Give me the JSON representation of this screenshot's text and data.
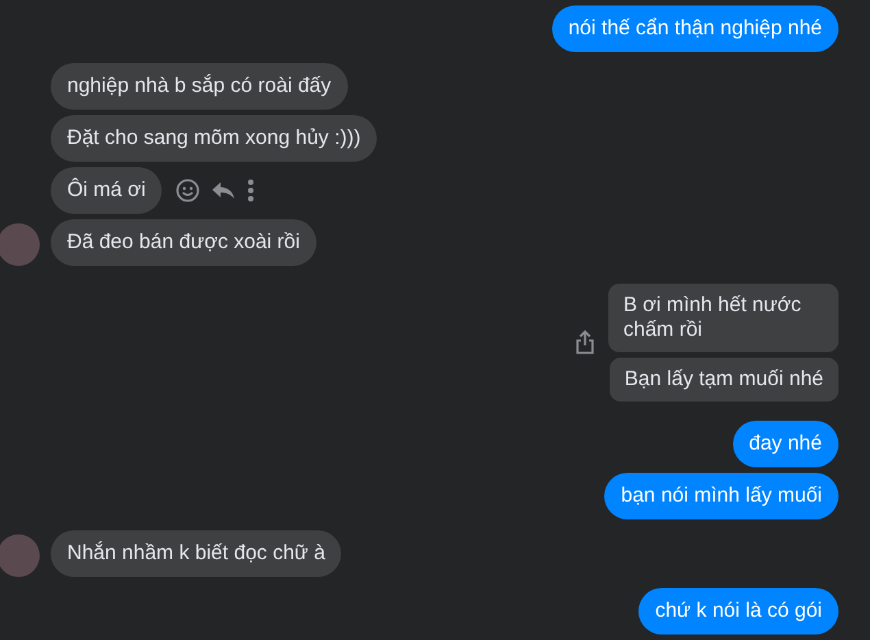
{
  "groups": [
    {
      "kind": "outgoing",
      "avatar": false,
      "share_icon": false,
      "messages": [
        {
          "text": "nói thế cẩn thận nghiệp nhé",
          "kind": "blue",
          "actions": false
        }
      ]
    },
    {
      "kind": "incoming",
      "avatar": true,
      "share_icon": false,
      "messages": [
        {
          "text": "nghiệp nhà b sắp có roài đấy",
          "kind": "grey",
          "actions": false
        },
        {
          "text": "Đặt cho sang mõm xong hủy :)))",
          "kind": "grey",
          "actions": false
        },
        {
          "text": "Ôi má ơi",
          "kind": "grey",
          "actions": true
        },
        {
          "text": "Đã đeo bán được xoài rồi",
          "kind": "grey",
          "actions": false
        }
      ]
    },
    {
      "kind": "outgoing",
      "avatar": false,
      "share_icon": true,
      "messages": [
        {
          "text": "B ơi mình hết nước chấm rồi",
          "kind": "grey",
          "actions": false
        },
        {
          "text": "Bạn lấy tạm muối nhé",
          "kind": "grey",
          "actions": false
        }
      ]
    },
    {
      "kind": "outgoing",
      "avatar": false,
      "share_icon": false,
      "messages": [
        {
          "text": "đay nhé",
          "kind": "blue",
          "actions": false
        },
        {
          "text": "bạn nói mình lấy muối",
          "kind": "blue",
          "actions": false
        }
      ]
    },
    {
      "kind": "incoming",
      "avatar": true,
      "share_icon": false,
      "messages": [
        {
          "text": "Nhắn nhầm k biết đọc chữ à",
          "kind": "grey",
          "actions": false
        }
      ]
    },
    {
      "kind": "outgoing",
      "avatar": false,
      "share_icon": false,
      "messages": [
        {
          "text": "chứ k nói là có gói",
          "kind": "blue",
          "actions": false
        }
      ]
    }
  ]
}
